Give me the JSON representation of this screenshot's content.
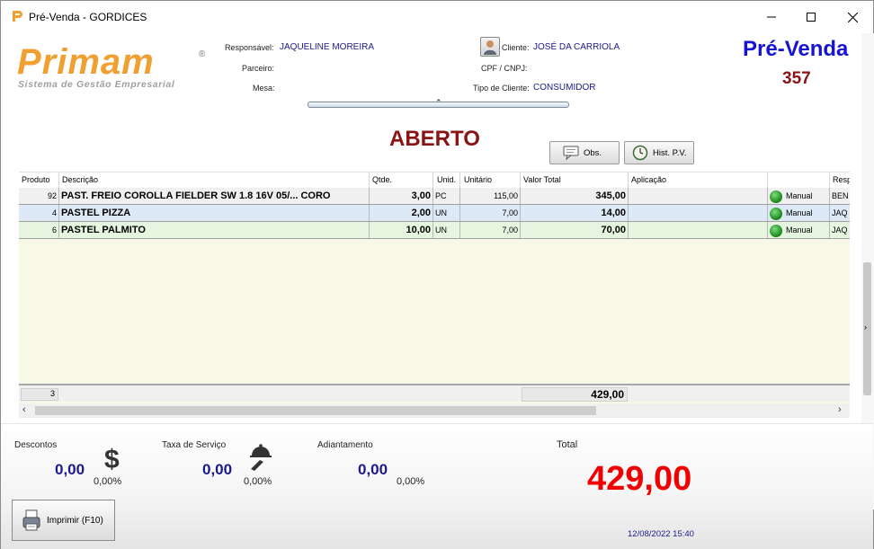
{
  "window": {
    "title": "Pré-Venda - GORDICES",
    "minimize_icon": "minimize-icon",
    "maximize_icon": "maximize-icon",
    "close_icon": "close-icon"
  },
  "header": {
    "logo_text": "Primam",
    "logo_subtitle": "Sistema de Gestão Empresarial",
    "responsavel_label": "Responsável:",
    "responsavel_value": "JAQUELINE MOREIRA",
    "parceiro_label": "Parceiro:",
    "parceiro_value": "",
    "mesa_label": "Mesa:",
    "mesa_value": "",
    "cliente_label": "Cliente:",
    "cliente_value": "JOSÉ DA CARRIOLA",
    "cpf_label": "CPF / CNPJ:",
    "cpf_value": "",
    "tipo_cliente_label": "Tipo de Cliente:",
    "tipo_cliente_value": "CONSUMIDOR",
    "pv_title": "Pré-Venda",
    "pv_number": "357",
    "status": "ABERTO",
    "obs_button": "Obs.",
    "hist_button": "Hist. P.V."
  },
  "grid": {
    "columns": [
      "Produto",
      "Descrição",
      "Qtde.",
      "Unid.",
      "Unitário",
      "Valor Total",
      "Aplicação",
      "",
      "Resp"
    ],
    "rows": [
      {
        "produto": "92",
        "descricao": "PAST. FREIO COROLLA FIELDER SW 1.8 16V 05/... CORO",
        "qtde": "3,00",
        "unid": "PC",
        "unitario": "115,00",
        "valor_total": "345,00",
        "aplicacao": "",
        "tipo": "Manual",
        "resp": "BEN"
      },
      {
        "produto": "4",
        "descricao": "PASTEL PIZZA",
        "qtde": "2,00",
        "unid": "UN",
        "unitario": "7,00",
        "valor_total": "14,00",
        "aplicacao": "",
        "tipo": "Manual",
        "resp": "JAQ"
      },
      {
        "produto": "6",
        "descricao": "PASTEL PALMITO",
        "qtde": "10,00",
        "unid": "UN",
        "unitario": "7,00",
        "valor_total": "70,00",
        "aplicacao": "",
        "tipo": "Manual",
        "resp": "JAQ"
      }
    ],
    "footer_count": "3",
    "footer_total": "429,00",
    "row_colors": [
      "#f0f0f0",
      "#dde9f6",
      "#e6f5e0"
    ]
  },
  "bottom": {
    "descontos_label": "Descontos",
    "descontos_value": "0,00",
    "descontos_pct": "0,00%",
    "taxa_label": "Taxa de Serviço",
    "taxa_value": "0,00",
    "taxa_pct": "0,00%",
    "adiantamento_label": "Adiantamento",
    "adiantamento_value": "0,00",
    "adiantamento_pct": "0,00%",
    "total_label": "Total",
    "total_value": "429,00",
    "datetime": "12/08/2022 15:40",
    "print_button": "Imprimir (F10)"
  },
  "colors": {
    "accent_blue": "#1414d2",
    "dark_red": "#8a1414",
    "total_red": "#f00000",
    "value_blue": "#1a1a8c",
    "logo_orange": "#f0a030"
  }
}
